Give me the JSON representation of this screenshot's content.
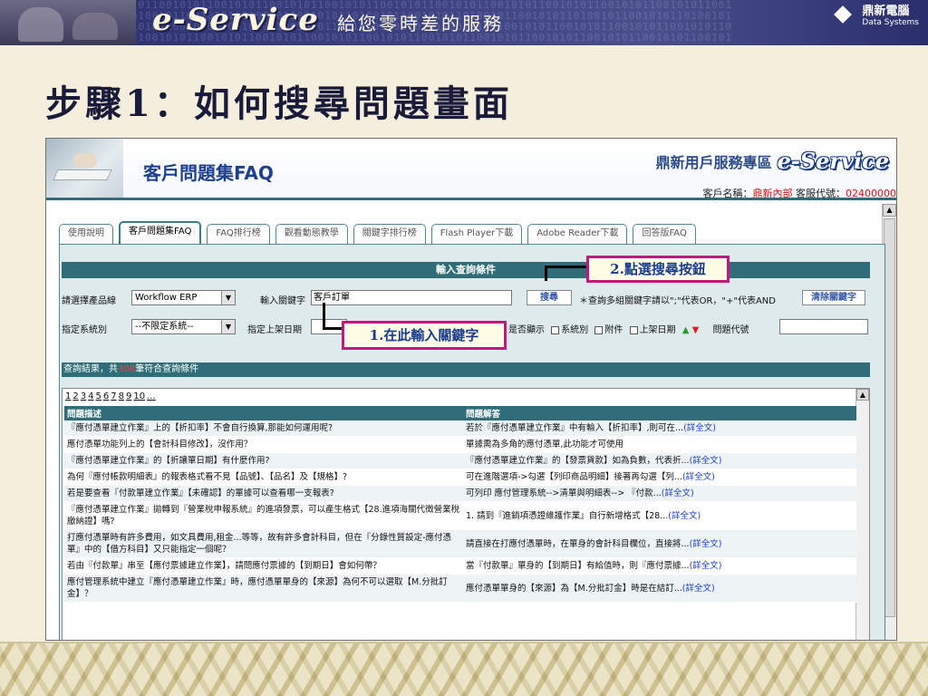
{
  "slide": {
    "banner_logo": "e-Service",
    "banner_sub": "給您零時差的服務",
    "brand_cn": "鼎新電腦",
    "brand_en": "Data Systems",
    "title": "步驟1：如何搜尋問題畫面"
  },
  "app": {
    "header_title": "客戶問題集FAQ",
    "zone_label": "鼎新用戶服務專區",
    "logo": "e-Service",
    "customer_label": "客戶名稱：",
    "customer_value": "鼎新內部",
    "service_label": "客服代號：",
    "service_value": "02400000"
  },
  "tabs": [
    {
      "label": "使用說明",
      "active": false
    },
    {
      "label": "客戶問題集FAQ",
      "active": true
    },
    {
      "label": "FAQ排行榜",
      "active": false
    },
    {
      "label": "觀看動態教學",
      "active": false
    },
    {
      "label": "關鍵字排行榜",
      "active": false
    },
    {
      "label": "Flash Player下載",
      "active": false
    },
    {
      "label": "Adobe Reader下載",
      "active": false
    },
    {
      "label": "回答版FAQ",
      "active": false
    }
  ],
  "search": {
    "header": "輸入查詢條件",
    "product_label": "請選擇產品線",
    "product_value": "Workflow ERP",
    "keyword_label": "輸入關鍵字",
    "keyword_value": "客戶訂單",
    "search_button": "搜尋",
    "hint": "＊查詢多組關鍵字請以\";\"代表OR，\"+\"代表AND",
    "clear_button": "清除關鍵字",
    "system_label": "指定系統別",
    "system_value": "--不限定系統--",
    "date_label": "指定上架日期",
    "display_label": "是否顯示",
    "chk_system": "系統別",
    "chk_attach": "附件",
    "chk_date": "上架日期",
    "code_label": "問題代號"
  },
  "callouts": {
    "c1": "1.在此輸入關鍵字",
    "c2": "2.點選搜尋按鈕"
  },
  "results": {
    "prefix": "查詢結果，共",
    "count": "308",
    "suffix": "筆符合查詢條件",
    "pages": [
      "1",
      "2",
      "3",
      "4",
      "5",
      "6",
      "7",
      "8",
      "9",
      "10",
      "..."
    ],
    "col_q": "問題描述",
    "col_a": "問題解答",
    "more": "(詳全文)",
    "rows": [
      {
        "q": "『應付憑單建立作業』上的【折扣率】不會自行換算,那能如何運用呢?",
        "a": "若於『應付憑單建立作業』中有輸入【折扣率】,則可在...",
        "more": true
      },
      {
        "q": "應付憑單功能列上的【會計科目修改】，沒作用？",
        "a": "單據需為多角的應付憑單,此功能才可使用",
        "more": false
      },
      {
        "q": "『應付憑單建立作業』的【折讓單日期】有什麼作用?",
        "a": "『應付憑單建立作業』的【發票貨款】如為負數，代表折...",
        "more": true
      },
      {
        "q": "為何『應付帳款明細表』的報表格式看不見【品號】、【品名】及【規格】?",
        "a": "可在進階選項->勾選【列印商品明細】接著再勾選【列...",
        "more": true
      },
      {
        "q": "若是要查看『付款單建立作業』【未確認】的單據可以查看哪一支報表?",
        "a": "可列印 應付管理系統-->清單與明細表--> 『付款...",
        "more": true
      },
      {
        "q": "『應付憑單建立作業』拋轉到『營業稅申報系統』的進項發票，可以產生格式【28.進項海關代徵營業稅繳納證】嗎?",
        "a": "1. 請到『進銷項憑證維護作業』自行新增格式【28...",
        "more": true
      },
      {
        "q": "打應付憑單時有許多費用，如文具費用,租金...等等，故有許多會計科目，但在『分錄性質設定-應付憑單』中的【借方科目】又只能指定一個呢？",
        "a": "請直接在打應付憑單時，在單身的會計科目欄位，直接將...",
        "more": true
      },
      {
        "q": "若由『付款單』串至【應付票據建立作業】，請問應付票據的【到期日】會如何帶？",
        "a": "當『付款單』單身的【到期日】有給值時，則『應付票據...",
        "more": true
      },
      {
        "q": "應付管理系統中建立『應付憑單建立作業』時，應付憑單單身的【來源】為何不可以選取【M.分批訂金】？",
        "a": "應付憑單單身的【來源】為【M.分批訂金】時是在結訂...",
        "more": true
      }
    ]
  },
  "colors": {
    "banner": "#2a2f6b",
    "teal": "#2f6d78",
    "callout_border": "#c0187c",
    "callout_text": "#1a3c8c",
    "link": "#1a3ccc"
  }
}
